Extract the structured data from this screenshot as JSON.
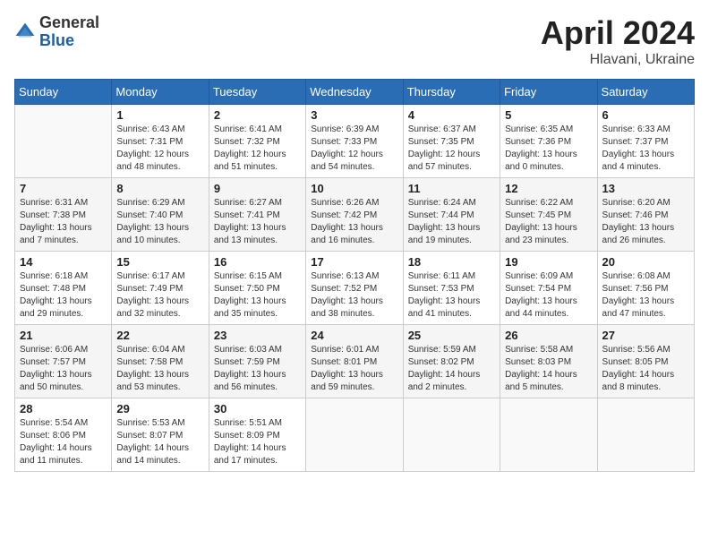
{
  "header": {
    "logo_general": "General",
    "logo_blue": "Blue",
    "title": "April 2024",
    "location": "Hlavani, Ukraine"
  },
  "weekdays": [
    "Sunday",
    "Monday",
    "Tuesday",
    "Wednesday",
    "Thursday",
    "Friday",
    "Saturday"
  ],
  "weeks": [
    [
      {
        "num": "",
        "sunrise": "",
        "sunset": "",
        "daylight": ""
      },
      {
        "num": "1",
        "sunrise": "Sunrise: 6:43 AM",
        "sunset": "Sunset: 7:31 PM",
        "daylight": "Daylight: 12 hours and 48 minutes."
      },
      {
        "num": "2",
        "sunrise": "Sunrise: 6:41 AM",
        "sunset": "Sunset: 7:32 PM",
        "daylight": "Daylight: 12 hours and 51 minutes."
      },
      {
        "num": "3",
        "sunrise": "Sunrise: 6:39 AM",
        "sunset": "Sunset: 7:33 PM",
        "daylight": "Daylight: 12 hours and 54 minutes."
      },
      {
        "num": "4",
        "sunrise": "Sunrise: 6:37 AM",
        "sunset": "Sunset: 7:35 PM",
        "daylight": "Daylight: 12 hours and 57 minutes."
      },
      {
        "num": "5",
        "sunrise": "Sunrise: 6:35 AM",
        "sunset": "Sunset: 7:36 PM",
        "daylight": "Daylight: 13 hours and 0 minutes."
      },
      {
        "num": "6",
        "sunrise": "Sunrise: 6:33 AM",
        "sunset": "Sunset: 7:37 PM",
        "daylight": "Daylight: 13 hours and 4 minutes."
      }
    ],
    [
      {
        "num": "7",
        "sunrise": "Sunrise: 6:31 AM",
        "sunset": "Sunset: 7:38 PM",
        "daylight": "Daylight: 13 hours and 7 minutes."
      },
      {
        "num": "8",
        "sunrise": "Sunrise: 6:29 AM",
        "sunset": "Sunset: 7:40 PM",
        "daylight": "Daylight: 13 hours and 10 minutes."
      },
      {
        "num": "9",
        "sunrise": "Sunrise: 6:27 AM",
        "sunset": "Sunset: 7:41 PM",
        "daylight": "Daylight: 13 hours and 13 minutes."
      },
      {
        "num": "10",
        "sunrise": "Sunrise: 6:26 AM",
        "sunset": "Sunset: 7:42 PM",
        "daylight": "Daylight: 13 hours and 16 minutes."
      },
      {
        "num": "11",
        "sunrise": "Sunrise: 6:24 AM",
        "sunset": "Sunset: 7:44 PM",
        "daylight": "Daylight: 13 hours and 19 minutes."
      },
      {
        "num": "12",
        "sunrise": "Sunrise: 6:22 AM",
        "sunset": "Sunset: 7:45 PM",
        "daylight": "Daylight: 13 hours and 23 minutes."
      },
      {
        "num": "13",
        "sunrise": "Sunrise: 6:20 AM",
        "sunset": "Sunset: 7:46 PM",
        "daylight": "Daylight: 13 hours and 26 minutes."
      }
    ],
    [
      {
        "num": "14",
        "sunrise": "Sunrise: 6:18 AM",
        "sunset": "Sunset: 7:48 PM",
        "daylight": "Daylight: 13 hours and 29 minutes."
      },
      {
        "num": "15",
        "sunrise": "Sunrise: 6:17 AM",
        "sunset": "Sunset: 7:49 PM",
        "daylight": "Daylight: 13 hours and 32 minutes."
      },
      {
        "num": "16",
        "sunrise": "Sunrise: 6:15 AM",
        "sunset": "Sunset: 7:50 PM",
        "daylight": "Daylight: 13 hours and 35 minutes."
      },
      {
        "num": "17",
        "sunrise": "Sunrise: 6:13 AM",
        "sunset": "Sunset: 7:52 PM",
        "daylight": "Daylight: 13 hours and 38 minutes."
      },
      {
        "num": "18",
        "sunrise": "Sunrise: 6:11 AM",
        "sunset": "Sunset: 7:53 PM",
        "daylight": "Daylight: 13 hours and 41 minutes."
      },
      {
        "num": "19",
        "sunrise": "Sunrise: 6:09 AM",
        "sunset": "Sunset: 7:54 PM",
        "daylight": "Daylight: 13 hours and 44 minutes."
      },
      {
        "num": "20",
        "sunrise": "Sunrise: 6:08 AM",
        "sunset": "Sunset: 7:56 PM",
        "daylight": "Daylight: 13 hours and 47 minutes."
      }
    ],
    [
      {
        "num": "21",
        "sunrise": "Sunrise: 6:06 AM",
        "sunset": "Sunset: 7:57 PM",
        "daylight": "Daylight: 13 hours and 50 minutes."
      },
      {
        "num": "22",
        "sunrise": "Sunrise: 6:04 AM",
        "sunset": "Sunset: 7:58 PM",
        "daylight": "Daylight: 13 hours and 53 minutes."
      },
      {
        "num": "23",
        "sunrise": "Sunrise: 6:03 AM",
        "sunset": "Sunset: 7:59 PM",
        "daylight": "Daylight: 13 hours and 56 minutes."
      },
      {
        "num": "24",
        "sunrise": "Sunrise: 6:01 AM",
        "sunset": "Sunset: 8:01 PM",
        "daylight": "Daylight: 13 hours and 59 minutes."
      },
      {
        "num": "25",
        "sunrise": "Sunrise: 5:59 AM",
        "sunset": "Sunset: 8:02 PM",
        "daylight": "Daylight: 14 hours and 2 minutes."
      },
      {
        "num": "26",
        "sunrise": "Sunrise: 5:58 AM",
        "sunset": "Sunset: 8:03 PM",
        "daylight": "Daylight: 14 hours and 5 minutes."
      },
      {
        "num": "27",
        "sunrise": "Sunrise: 5:56 AM",
        "sunset": "Sunset: 8:05 PM",
        "daylight": "Daylight: 14 hours and 8 minutes."
      }
    ],
    [
      {
        "num": "28",
        "sunrise": "Sunrise: 5:54 AM",
        "sunset": "Sunset: 8:06 PM",
        "daylight": "Daylight: 14 hours and 11 minutes."
      },
      {
        "num": "29",
        "sunrise": "Sunrise: 5:53 AM",
        "sunset": "Sunset: 8:07 PM",
        "daylight": "Daylight: 14 hours and 14 minutes."
      },
      {
        "num": "30",
        "sunrise": "Sunrise: 5:51 AM",
        "sunset": "Sunset: 8:09 PM",
        "daylight": "Daylight: 14 hours and 17 minutes."
      },
      {
        "num": "",
        "sunrise": "",
        "sunset": "",
        "daylight": ""
      },
      {
        "num": "",
        "sunrise": "",
        "sunset": "",
        "daylight": ""
      },
      {
        "num": "",
        "sunrise": "",
        "sunset": "",
        "daylight": ""
      },
      {
        "num": "",
        "sunrise": "",
        "sunset": "",
        "daylight": ""
      }
    ]
  ]
}
